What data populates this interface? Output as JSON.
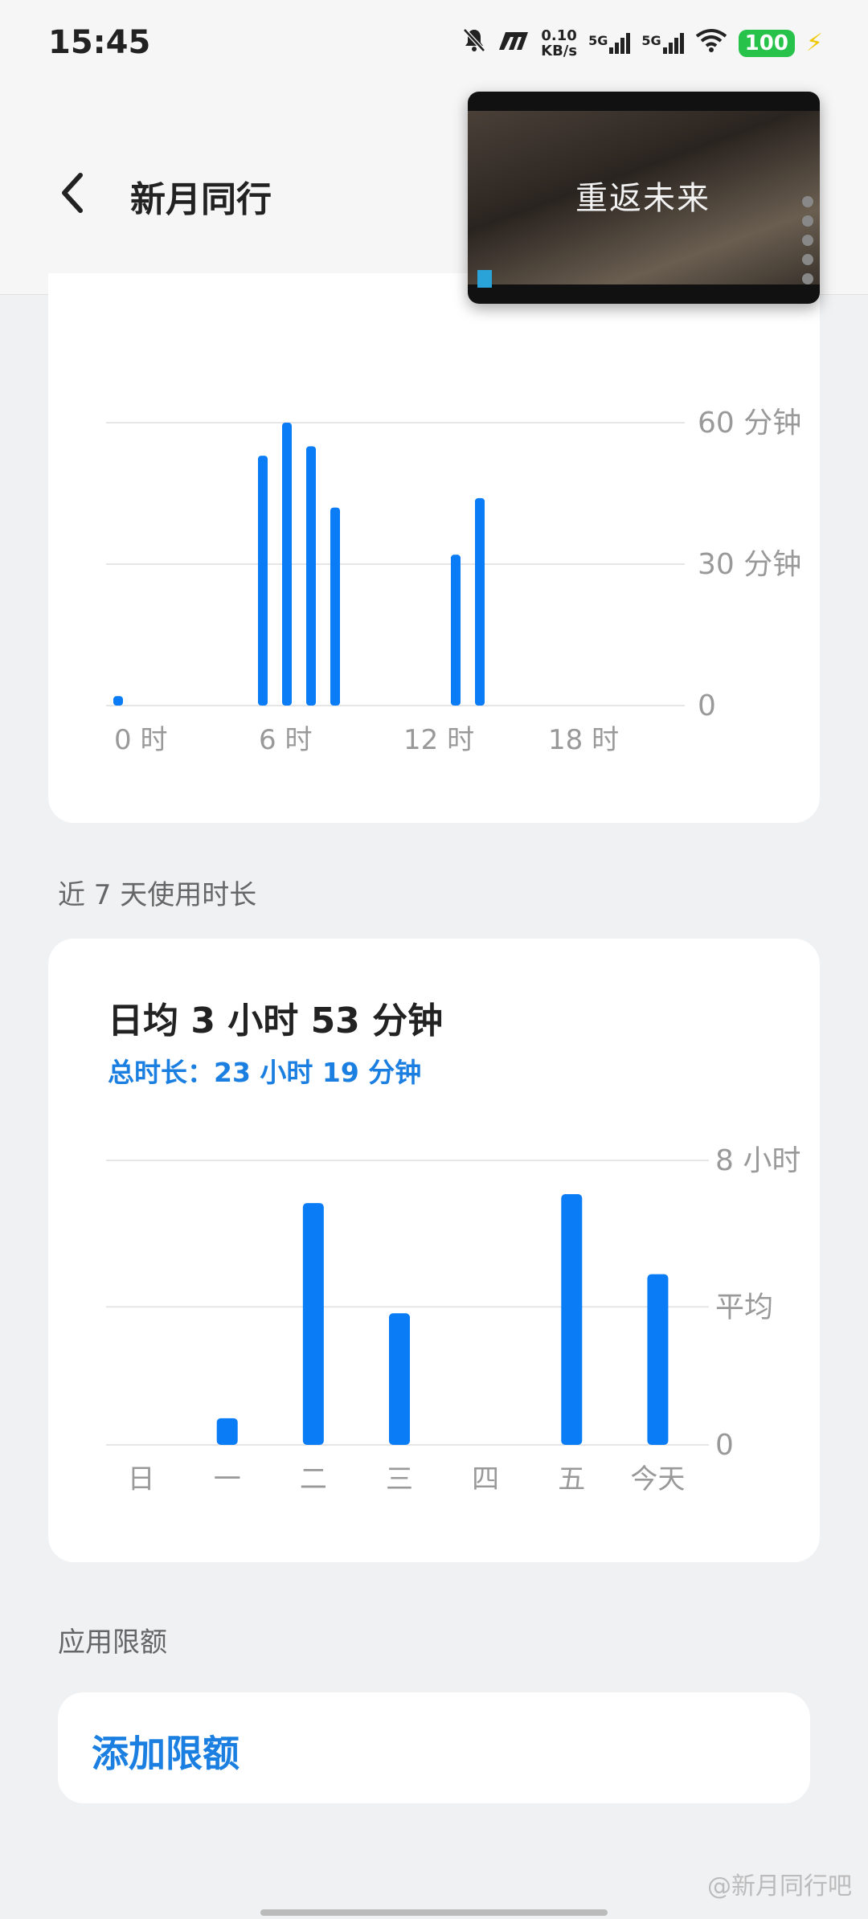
{
  "status_bar": {
    "time": "15:45",
    "net_speed_value": "0.10",
    "net_speed_unit": "KB/s",
    "sim1_label": "5G",
    "sim2_label": "5G",
    "battery": "100",
    "icons": [
      "mute-bell-icon",
      "app-m-icon",
      "wifi-icon",
      "charging-bolt-icon"
    ]
  },
  "header": {
    "title": "新月同行",
    "back_icon": "chevron-left-icon"
  },
  "pip_overlay": {
    "caption": "重返未来"
  },
  "hourly_chart": {
    "chart_data": {
      "type": "bar",
      "x_unit": "hour",
      "x_ticks": [
        "0 时",
        "6 时",
        "12 时",
        "18 时"
      ],
      "y_ticks": [
        "60 分钟",
        "30 分钟",
        "0"
      ],
      "ylim": [
        0,
        60
      ],
      "values_by_hour": [
        2,
        0,
        0,
        0,
        0,
        0,
        53,
        60,
        55,
        42,
        0,
        0,
        0,
        0,
        32,
        44,
        0,
        0,
        0,
        0,
        0,
        0,
        0,
        0
      ],
      "color": "#0a7cf5",
      "grid": true
    }
  },
  "weekly_section": {
    "label": "近 7 天使用时长",
    "avg_title": "日均 3 小时 53 分钟",
    "total": "总时长：23 小时 19 分钟",
    "chart_data": {
      "type": "bar",
      "categories": [
        "日",
        "一",
        "二",
        "三",
        "四",
        "五",
        "今天"
      ],
      "values": [
        0,
        0.75,
        6.8,
        3.7,
        0,
        7.05,
        4.8
      ],
      "y_ticks": [
        "8 小时",
        "平均",
        "0"
      ],
      "ylim": [
        0,
        8
      ],
      "average_line": 3.88,
      "color": "#0a7cf5",
      "grid": true
    }
  },
  "limit_section": {
    "label": "应用限额",
    "add_button": "添加限额"
  },
  "watermark": "@新月同行吧"
}
